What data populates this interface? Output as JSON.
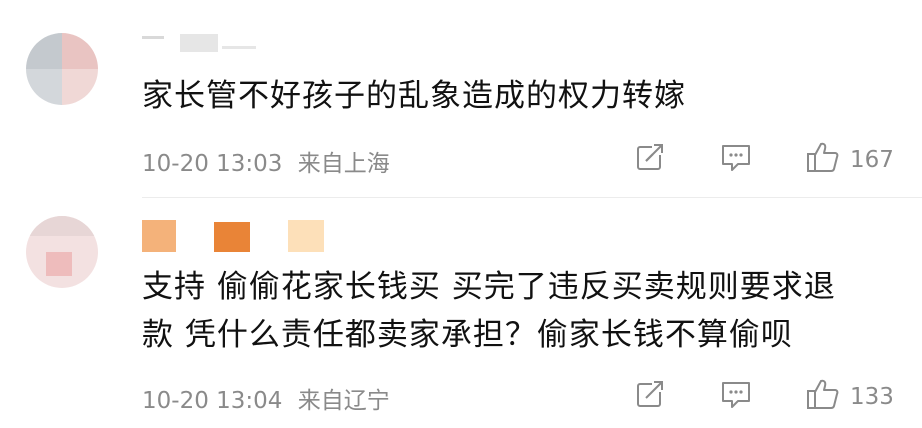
{
  "comments": [
    {
      "text": "家长管不好孩子的乱象造成的权力转嫁",
      "timestamp": "10-20 13:03",
      "location": "来自上海",
      "like_count": "167",
      "username_blur_colors": [
        "#d9d9d9",
        "#e6e6e6"
      ],
      "avatar_blur_colors": [
        "#c4c9ce",
        "#e9c4c2",
        "#f0d8d6",
        "#d3d7db"
      ]
    },
    {
      "text_line1": "支持 偷偷花家长钱买 买完了违反买卖规则要求退",
      "text_line2": "款 凭什么责任都卖家承担？偷家长钱不算偷呗",
      "timestamp": "10-20 13:04",
      "location": "来自辽宁",
      "like_count": "133",
      "username_blur_colors": [
        "#f4b27a",
        "#e98437",
        "#fde0b9"
      ],
      "avatar_blur_colors": [
        "#e7d6d6",
        "#eebcbc",
        "#f3e1e1"
      ]
    }
  ],
  "icons": {
    "share": "share-icon",
    "reply": "comment-icon",
    "like": "thumbs-up-icon"
  },
  "colors": {
    "text": "#111111",
    "meta": "#8a8a8a",
    "icon": "#8a8a8a"
  }
}
